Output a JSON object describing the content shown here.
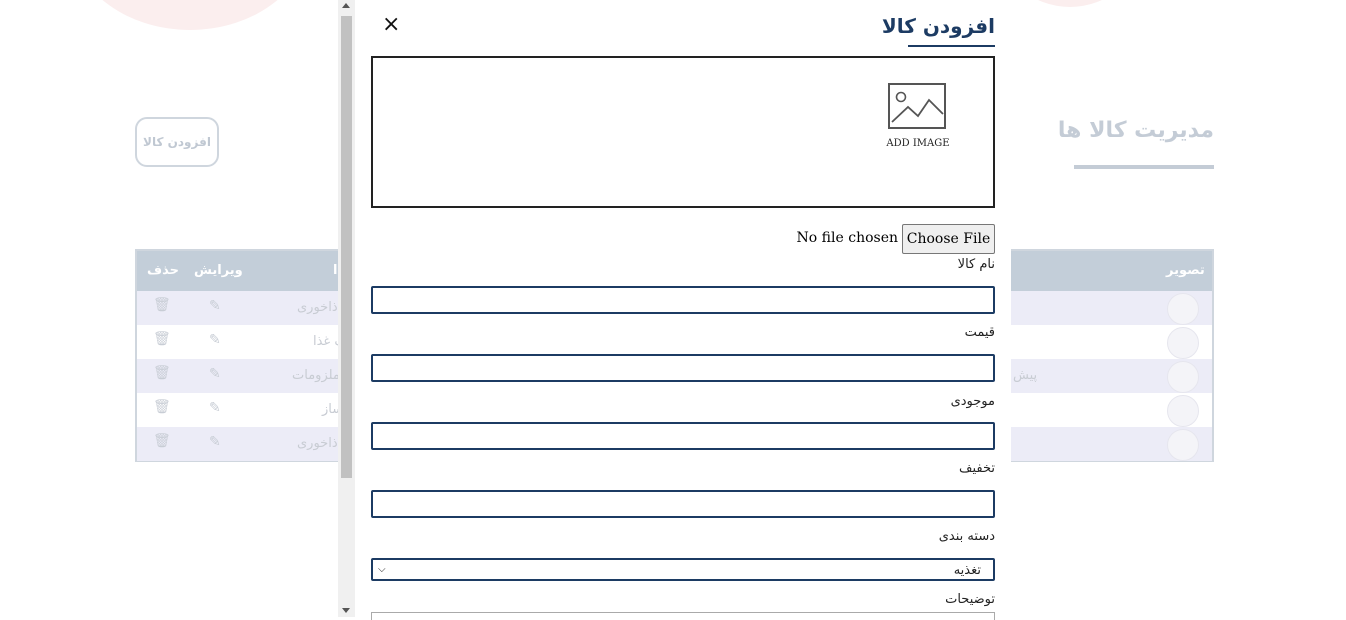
{
  "background": {
    "page_title": "مدیریت کالا ها",
    "add_button_label": "افزودن کالا",
    "table": {
      "headers": {
        "image": "تصویر",
        "name_partial": "ا",
        "edit": "ویرایش",
        "delete": "حذف"
      },
      "rows": [
        {
          "text": "ذاخوری",
          "alt": true
        },
        {
          "text": "ف غذا",
          "alt": false
        },
        {
          "text": "ملزومات",
          "left_text": "پیش",
          "alt": true
        },
        {
          "text": "ساز",
          "alt": false
        },
        {
          "text": "ذاخوری",
          "alt": true
        }
      ]
    }
  },
  "modal": {
    "title": "افزودن کالا",
    "close_label": "×",
    "image_upload": {
      "caption": "ADD IMAGE",
      "icon": "image-placeholder-icon"
    },
    "file_input": {
      "button_label": "Choose File",
      "status": "No file chosen"
    },
    "fields": {
      "name_label": "نام کالا",
      "price_label": "قیمت",
      "stock_label": "موجودی",
      "discount_label": "تخفیف",
      "category_label": "دسته بندی",
      "category_value": "تغذیه",
      "description_label": "توضیحات"
    }
  },
  "colors": {
    "accent": "#1c3b63",
    "table_header": "#c3ced9",
    "dimmed_text": "#c4ccd6"
  }
}
